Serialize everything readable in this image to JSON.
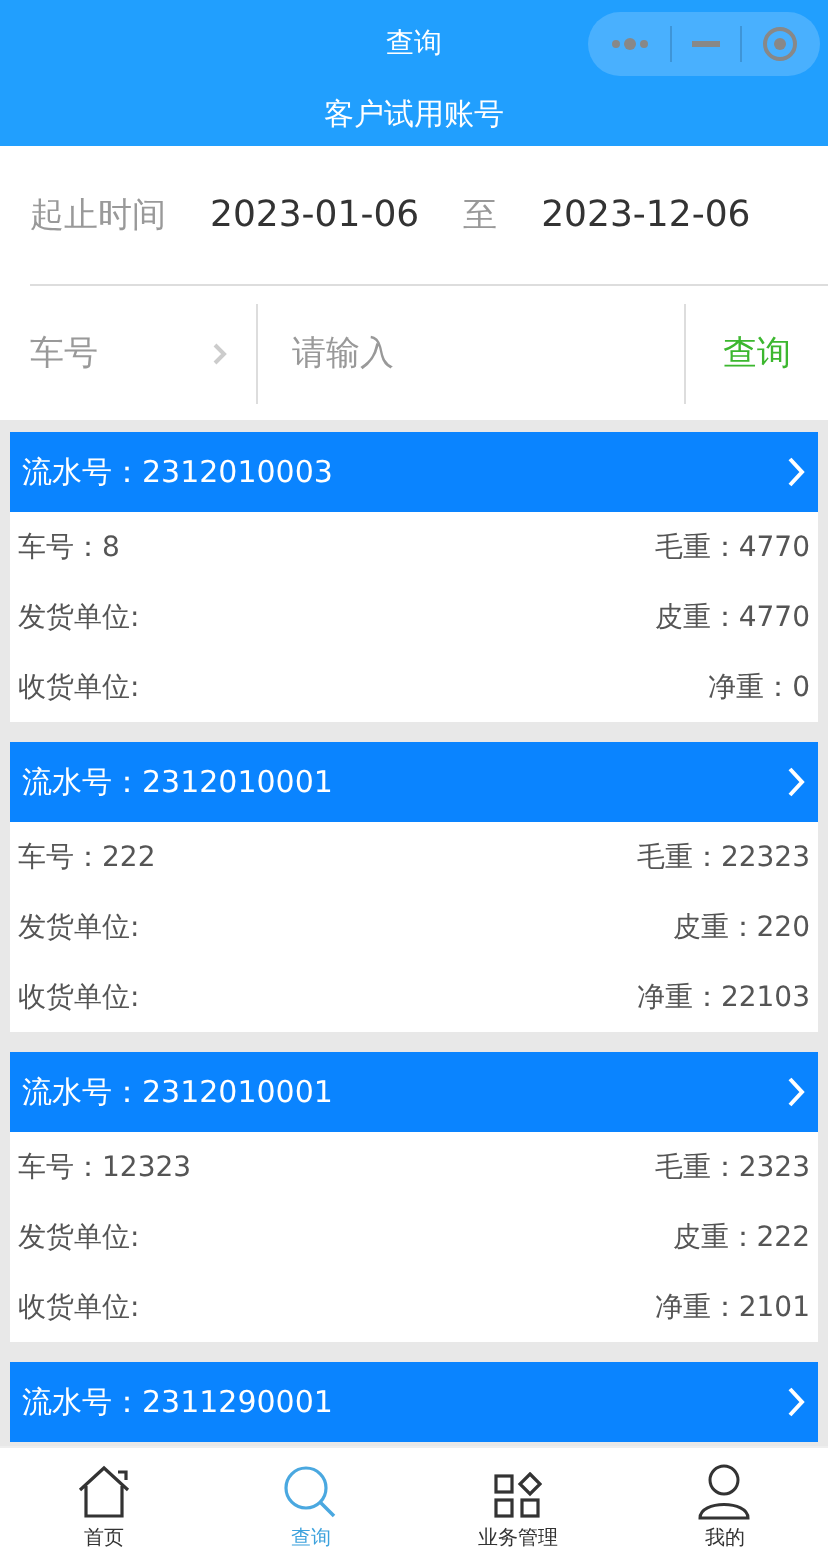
{
  "nav": {
    "title": "查询",
    "subtitle": "客户试用账号"
  },
  "date_range": {
    "label": "起止时间",
    "start": "2023-01-06",
    "separator": "至",
    "end": "2023-12-06"
  },
  "search": {
    "field_label": "车号",
    "placeholder": "请输入",
    "button": "查询"
  },
  "records": [
    {
      "serial": "流水号：2312010003",
      "plate": "车号：8",
      "gross": "毛重：4770",
      "sender": "发货单位:",
      "tare": "皮重：4770",
      "receiver": "收货单位:",
      "net": "净重：0"
    },
    {
      "serial": "流水号：2312010001",
      "plate": "车号：222",
      "gross": "毛重：22323",
      "sender": "发货单位:",
      "tare": "皮重：220",
      "receiver": "收货单位:",
      "net": "净重：22103"
    },
    {
      "serial": "流水号：2312010001",
      "plate": "车号：12323",
      "gross": "毛重：2323",
      "sender": "发货单位:",
      "tare": "皮重：222",
      "receiver": "收货单位:",
      "net": "净重：2101"
    },
    {
      "serial": "流水号：2311290001"
    }
  ],
  "tabbar": [
    {
      "label": "首页",
      "kind": "home",
      "selected": false
    },
    {
      "label": "查询",
      "kind": "search",
      "selected": true
    },
    {
      "label": "业务管理",
      "kind": "grid",
      "selected": false
    },
    {
      "label": "我的",
      "kind": "user",
      "selected": false
    }
  ]
}
